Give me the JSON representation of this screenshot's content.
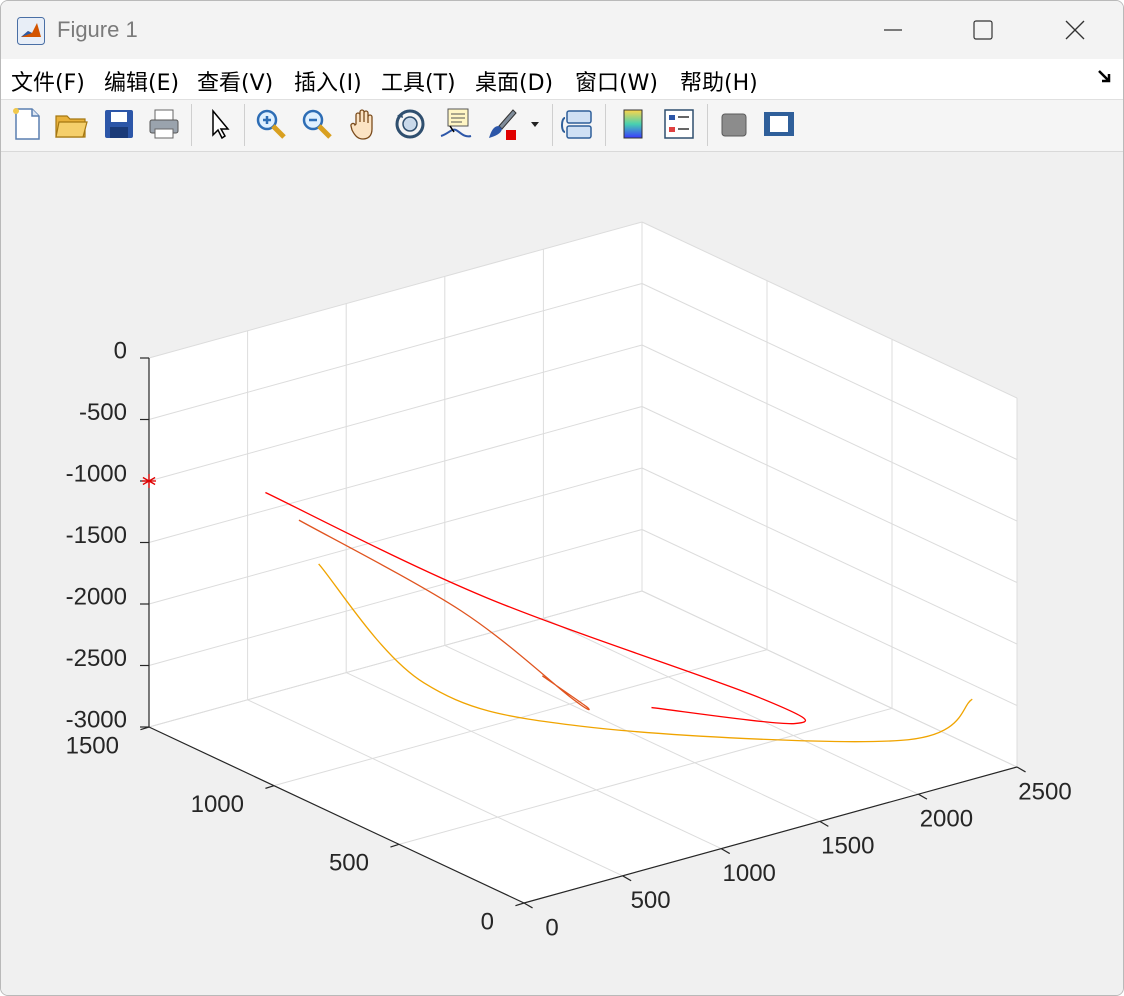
{
  "window": {
    "title": "Figure 1",
    "app_icon": "matlab-icon",
    "controls": [
      "minimize-icon",
      "maximize-icon",
      "close-icon"
    ]
  },
  "menu": {
    "items": [
      {
        "label": "文件(F)"
      },
      {
        "label": "编辑(E)"
      },
      {
        "label": "查看(V)"
      },
      {
        "label": "插入(I)"
      },
      {
        "label": "工具(T)"
      },
      {
        "label": "桌面(D)"
      },
      {
        "label": "窗口(W)"
      },
      {
        "label": "帮助(H)"
      }
    ],
    "dock_icon": "dock-arrow-icon"
  },
  "toolbar": {
    "buttons": [
      "new-figure-icon",
      "open-file-icon",
      "save-icon",
      "print-icon",
      "select-pointer-icon",
      "zoom-in-icon",
      "zoom-out-icon",
      "pan-hand-icon",
      "rotate-3d-icon",
      "data-tips-icon",
      "brush-icon",
      "brush-dropdown-icon",
      "link-plot-icon",
      "colorbar-icon",
      "legend-icon",
      "hide-plot-tools-icon",
      "show-plot-tools-icon"
    ]
  },
  "colors": {
    "curve_1": "#ff0000",
    "curve_2": "#e0541f",
    "curve_3": "#f0a400",
    "marker": "#e00000",
    "grid": "#dcdcdc",
    "axes_bg": "#ffffff"
  },
  "chart_data": {
    "type": "line",
    "projection": "3d",
    "grid": true,
    "xlim": [
      0,
      2500
    ],
    "ylim": [
      0,
      1500
    ],
    "zlim": [
      -3000,
      0
    ],
    "x_ticks": [
      "0",
      "500",
      "1000",
      "1500",
      "2000",
      "2500"
    ],
    "y_ticks": [
      "0",
      "500",
      "1000",
      "1500"
    ],
    "z_ticks": [
      "0",
      "-500",
      "-1000",
      "-1500",
      "-2000",
      "-2500",
      "-3000"
    ],
    "markers": [
      {
        "symbol": "*",
        "color": "#e00000",
        "x": 0,
        "y": 1500,
        "z": -1000
      }
    ],
    "series": [
      {
        "color": "#ff0000",
        "points": [
          [
            210,
            1200,
            -900
          ],
          [
            1330,
            1200,
            -2250
          ],
          [
            2150,
            750,
            -3000
          ],
          [
            1500,
            100,
            -2300
          ],
          [
            900,
            200,
            -2000
          ]
        ]
      },
      {
        "color": "#e0541f",
        "points": [
          [
            380,
            1200,
            -1200
          ],
          [
            950,
            1000,
            -2000
          ],
          [
            1380,
            900,
            -2800
          ],
          [
            950,
            500,
            -2300
          ],
          [
            600,
            400,
            -1800
          ]
        ]
      },
      {
        "color": "#f0a400",
        "points": [
          [
            480,
            1200,
            -1600
          ],
          [
            760,
            1000,
            -2500
          ],
          [
            1300,
            800,
            -2900
          ],
          [
            2100,
            150,
            -2750
          ],
          [
            2400,
            100,
            -2500
          ]
        ]
      }
    ]
  }
}
